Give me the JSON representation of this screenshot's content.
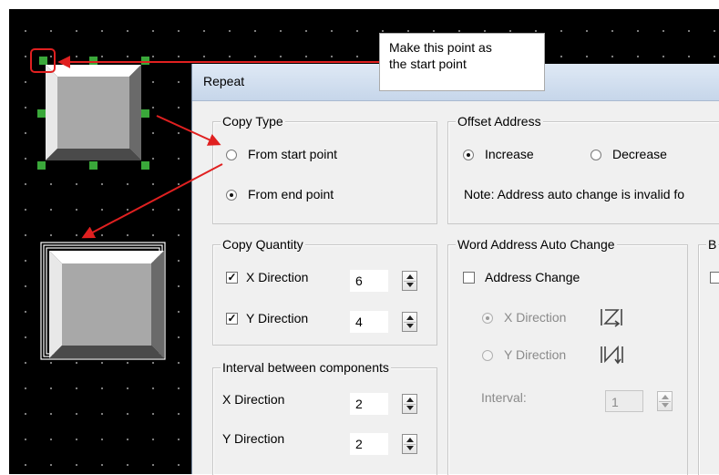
{
  "annotation": {
    "callout_text": "Make this point as\nthe start point"
  },
  "dialog": {
    "title": "Repeat",
    "copy_type": {
      "title": "Copy Type",
      "options": [
        {
          "label": "From start point",
          "checked": false
        },
        {
          "label": "From end point",
          "checked": true
        }
      ]
    },
    "offset_address": {
      "title": "Offset Address",
      "options": [
        {
          "label": "Increase",
          "checked": true
        },
        {
          "label": "Decrease",
          "checked": false
        }
      ],
      "note": "Note: Address auto change is invalid fo"
    },
    "copy_quantity": {
      "title": "Copy Quantity",
      "x": {
        "label": "X Direction",
        "checked": true,
        "value": "6"
      },
      "y": {
        "label": "Y Direction",
        "checked": true,
        "value": "4"
      }
    },
    "word_address": {
      "title": "Word Address Auto Change",
      "address_change": {
        "label": "Address Change",
        "checked": false
      },
      "x": {
        "label": "X Direction",
        "checked": true
      },
      "y": {
        "label": "Y Direction",
        "checked": false
      },
      "interval": {
        "label": "Interval:",
        "value": "1"
      }
    },
    "interval_components": {
      "title": "Interval between components",
      "x": {
        "label": "X Direction",
        "value": "2"
      },
      "y": {
        "label": "Y Direction",
        "value": "2"
      }
    },
    "partial_group": {
      "title": "B"
    }
  }
}
